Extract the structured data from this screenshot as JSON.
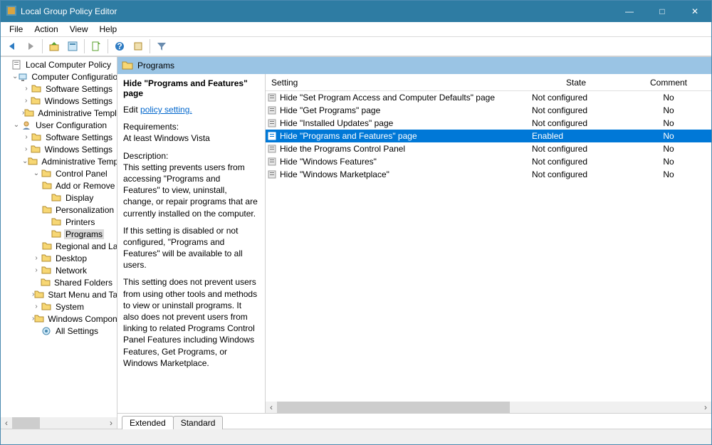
{
  "window": {
    "title": "Local Group Policy Editor"
  },
  "menu": {
    "items": [
      "File",
      "Action",
      "View",
      "Help"
    ]
  },
  "toolbar": {
    "back": "back-arrow",
    "forward": "forward-arrow",
    "up": "up-folder",
    "props": "properties",
    "refresh": "refresh",
    "help": "help",
    "export": "export",
    "filter": "filter"
  },
  "tree": {
    "root": "Local Computer Policy",
    "nodes": [
      {
        "indent": 0,
        "exp": "",
        "icon": "policy",
        "label": "Local Computer Policy"
      },
      {
        "indent": 1,
        "exp": "v",
        "icon": "computer",
        "label": "Computer Configuration"
      },
      {
        "indent": 2,
        "exp": ">",
        "icon": "folder",
        "label": "Software Settings"
      },
      {
        "indent": 2,
        "exp": ">",
        "icon": "folder",
        "label": "Windows Settings"
      },
      {
        "indent": 2,
        "exp": ">",
        "icon": "folder",
        "label": "Administrative Templates"
      },
      {
        "indent": 1,
        "exp": "v",
        "icon": "user",
        "label": "User Configuration"
      },
      {
        "indent": 2,
        "exp": ">",
        "icon": "folder",
        "label": "Software Settings"
      },
      {
        "indent": 2,
        "exp": ">",
        "icon": "folder",
        "label": "Windows Settings"
      },
      {
        "indent": 2,
        "exp": "v",
        "icon": "folder",
        "label": "Administrative Templates"
      },
      {
        "indent": 3,
        "exp": "v",
        "icon": "folder",
        "label": "Control Panel"
      },
      {
        "indent": 4,
        "exp": "",
        "icon": "folder",
        "label": "Add or Remove Programs"
      },
      {
        "indent": 4,
        "exp": "",
        "icon": "folder",
        "label": "Display"
      },
      {
        "indent": 4,
        "exp": "",
        "icon": "folder",
        "label": "Personalization"
      },
      {
        "indent": 4,
        "exp": "",
        "icon": "folder",
        "label": "Printers"
      },
      {
        "indent": 4,
        "exp": "",
        "icon": "folder",
        "label": "Programs",
        "sel": true
      },
      {
        "indent": 4,
        "exp": "",
        "icon": "folder",
        "label": "Regional and Language"
      },
      {
        "indent": 3,
        "exp": ">",
        "icon": "folder",
        "label": "Desktop"
      },
      {
        "indent": 3,
        "exp": ">",
        "icon": "folder",
        "label": "Network"
      },
      {
        "indent": 3,
        "exp": "",
        "icon": "folder",
        "label": "Shared Folders"
      },
      {
        "indent": 3,
        "exp": ">",
        "icon": "folder",
        "label": "Start Menu and Taskbar"
      },
      {
        "indent": 3,
        "exp": ">",
        "icon": "folder",
        "label": "System"
      },
      {
        "indent": 3,
        "exp": ">",
        "icon": "folder",
        "label": "Windows Components"
      },
      {
        "indent": 3,
        "exp": "",
        "icon": "settings",
        "label": "All Settings"
      }
    ]
  },
  "panel": {
    "header": "Programs",
    "desc": {
      "title": "Hide \"Programs and Features\" page",
      "edit_prefix": "Edit ",
      "edit_link": "policy setting.",
      "req_label": "Requirements:",
      "req_value": "At least Windows Vista",
      "desc_label": "Description:",
      "p1": "This setting prevents users from accessing \"Programs and Features\" to view, uninstall, change, or repair programs that are currently installed on the computer.",
      "p2": "If this setting is disabled or not configured, \"Programs and Features\" will be available to all users.",
      "p3": "This setting does not prevent users from using other tools and methods to view or uninstall programs.  It also does not prevent users from linking to related Programs Control Panel Features including Windows Features, Get Programs, or Windows Marketplace."
    },
    "columns": {
      "setting": "Setting",
      "state": "State",
      "comment": "Comment"
    },
    "rows": [
      {
        "label": "Hide \"Set Program Access and Computer Defaults\" page",
        "state": "Not configured",
        "comment": "No"
      },
      {
        "label": "Hide \"Get Programs\" page",
        "state": "Not configured",
        "comment": "No"
      },
      {
        "label": "Hide \"Installed Updates\" page",
        "state": "Not configured",
        "comment": "No"
      },
      {
        "label": "Hide \"Programs and Features\" page",
        "state": "Enabled",
        "comment": "No",
        "selected": true
      },
      {
        "label": "Hide the Programs Control Panel",
        "state": "Not configured",
        "comment": "No"
      },
      {
        "label": "Hide \"Windows Features\"",
        "state": "Not configured",
        "comment": "No"
      },
      {
        "label": "Hide \"Windows Marketplace\"",
        "state": "Not configured",
        "comment": "No"
      }
    ],
    "tabs": {
      "extended": "Extended",
      "standard": "Standard"
    }
  }
}
